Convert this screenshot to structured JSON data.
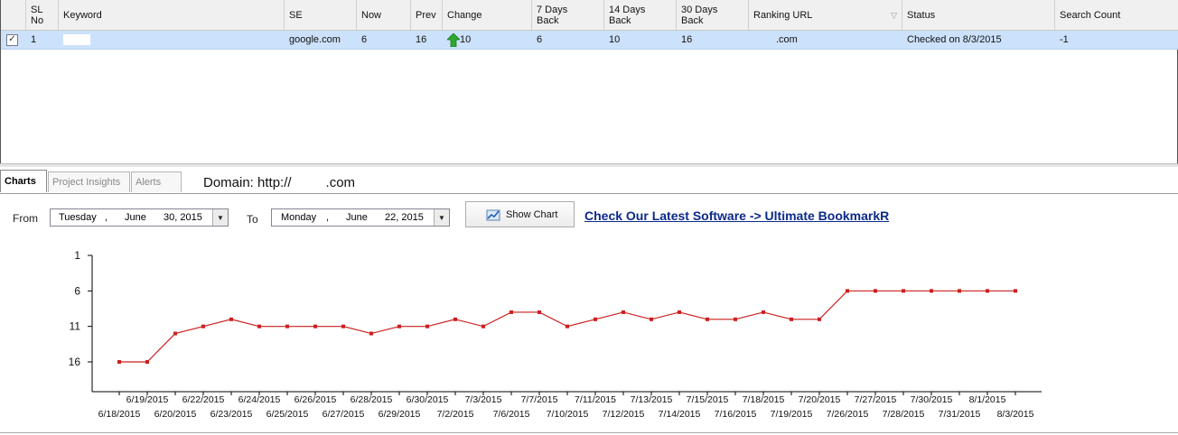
{
  "grid": {
    "columns": [
      {
        "label": ""
      },
      {
        "label": "SL\nNo"
      },
      {
        "label": "Keyword"
      },
      {
        "label": "SE"
      },
      {
        "label": "Now"
      },
      {
        "label": "Prev"
      },
      {
        "label": "Change"
      },
      {
        "label": "7 Days\nBack"
      },
      {
        "label": "14 Days\nBack"
      },
      {
        "label": "30 Days\nBack"
      },
      {
        "label": "Ranking URL"
      },
      {
        "label": "Status"
      },
      {
        "label": "Search Count"
      }
    ],
    "rows": [
      {
        "checked": "✓",
        "sl_no": "1",
        "keyword": "",
        "se": "google.com",
        "now": "6",
        "prev": "16",
        "change": "10",
        "days7": "6",
        "days14": "10",
        "days30": "16",
        "ranking_url": ".com",
        "status": "Checked on 8/3/2015",
        "search_count": "-1"
      }
    ]
  },
  "tabs": [
    {
      "label": "Charts",
      "active": true
    },
    {
      "label": "Project Insights",
      "active": false
    },
    {
      "label": "Alerts",
      "active": false
    }
  ],
  "domain_label": "Domain: http://",
  "domain_suffix": ".com",
  "from": {
    "label": "From",
    "weekday": "Tuesday",
    "sep": ",",
    "month": "June",
    "day_year": "30, 2015"
  },
  "to": {
    "label": "To",
    "weekday": "Monday",
    "sep": ",",
    "month": "June",
    "day_year": "22, 2015"
  },
  "show_chart_label": "Show Chart",
  "promo_link": "Check Our Latest Software -> Ultimate BookmarkR",
  "colors": {
    "line": "#cc1f1f",
    "row_selected": "#cce1fb",
    "promo": "#0b2a8a",
    "change_arrow": "#2fa82f"
  },
  "chart_data": {
    "type": "line",
    "title": "",
    "xlabel": "",
    "ylabel": "",
    "y_reversed": true,
    "ylim": [
      1,
      16
    ],
    "y_ticks": [
      1,
      6,
      11,
      16
    ],
    "x": [
      "6/18/2015",
      "6/19/2015",
      "6/20/2015",
      "6/22/2015",
      "6/23/2015",
      "6/24/2015",
      "6/25/2015",
      "6/26/2015",
      "6/27/2015",
      "6/28/2015",
      "6/29/2015",
      "6/30/2015",
      "7/2/2015",
      "7/3/2015",
      "7/6/2015",
      "7/7/2015",
      "7/10/2015",
      "7/11/2015",
      "7/12/2015",
      "7/13/2015",
      "7/14/2015",
      "7/15/2015",
      "7/16/2015",
      "7/18/2015",
      "7/19/2015",
      "7/20/2015",
      "7/26/2015",
      "7/27/2015",
      "7/28/2015",
      "7/30/2015",
      "7/31/2015",
      "8/1/2015",
      "8/3/2015"
    ],
    "series": [
      {
        "values": [
          16,
          16,
          12,
          11,
          10,
          11,
          11,
          11,
          11,
          12,
          11,
          11,
          10,
          11,
          9,
          9,
          11,
          10,
          9,
          10,
          9,
          10,
          10,
          9,
          10,
          10,
          6,
          6,
          6,
          6,
          6,
          6,
          6
        ]
      }
    ]
  }
}
